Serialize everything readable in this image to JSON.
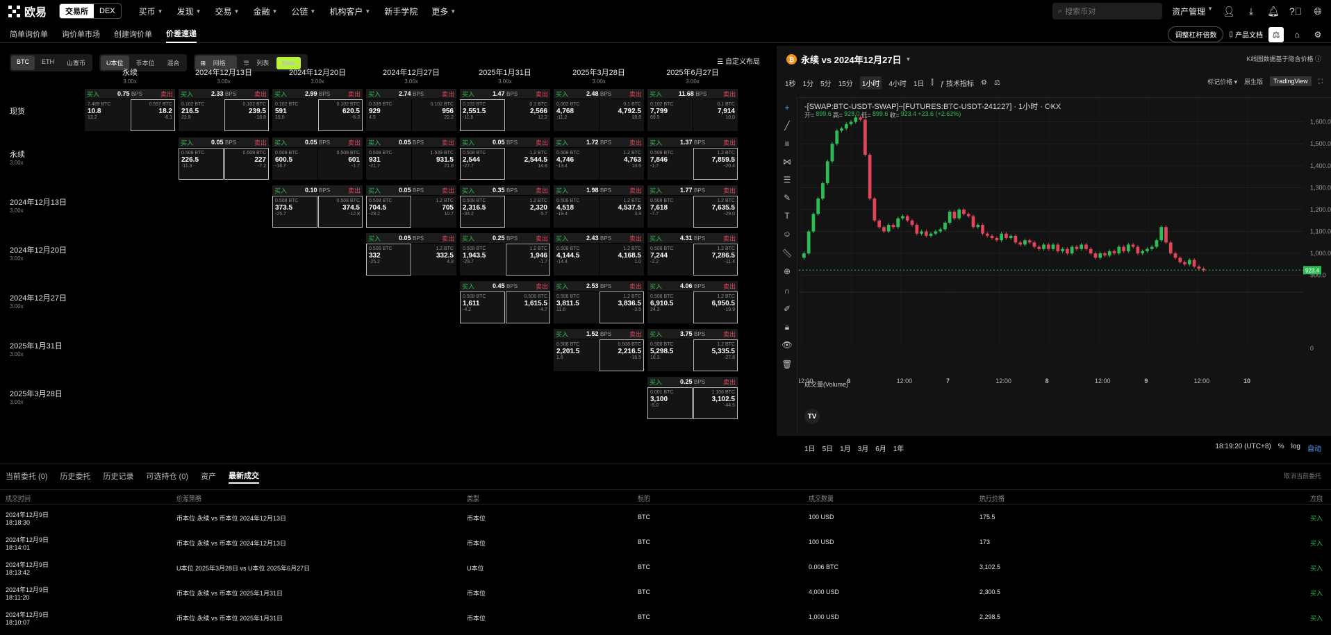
{
  "topnav": {
    "logo": "欧易",
    "mode_exchange": "交易所",
    "mode_dex": "DEX",
    "items": [
      "买币",
      "发现",
      "交易",
      "金融",
      "公链",
      "机构客户",
      "新手学院",
      "更多"
    ],
    "search_placeholder": "搜索币对",
    "asset_mgmt": "资产管理"
  },
  "subnav": {
    "items": [
      "简单询价单",
      "询价单市场",
      "创建询价单",
      "价差速递"
    ],
    "active_index": 3,
    "adjust_leverage": "调整杠杆倍数",
    "product_docs": "产品文档"
  },
  "filters": {
    "coins": [
      "BTC",
      "ETH",
      "山寨币"
    ],
    "units": [
      "U本位",
      "币本位",
      "混合"
    ],
    "views": [
      "网格",
      "列表"
    ],
    "new_badge": "New",
    "custom_layout": "自定义布局"
  },
  "grid": {
    "columns": [
      {
        "title": "永续",
        "multiplier": "3.00x"
      },
      {
        "title": "2024年12月13日",
        "multiplier": "3.00x"
      },
      {
        "title": "2024年12月20日",
        "multiplier": "3.00x"
      },
      {
        "title": "2024年12月27日",
        "multiplier": "3.00x"
      },
      {
        "title": "2025年1月31日",
        "multiplier": "3.00x"
      },
      {
        "title": "2025年3月28日",
        "multiplier": "3.00x"
      },
      {
        "title": "2025年6月27日",
        "multiplier": "3.00x"
      }
    ],
    "rows": [
      {
        "title": "现货",
        "multiplier": ""
      },
      {
        "title": "永续",
        "multiplier": "3.00x"
      },
      {
        "title": "2024年12月13日",
        "multiplier": "3.00x"
      },
      {
        "title": "2024年12月20日",
        "multiplier": "3.00x"
      },
      {
        "title": "2024年12月27日",
        "multiplier": "3.00x"
      },
      {
        "title": "2025年1月31日",
        "multiplier": "3.00x"
      },
      {
        "title": "2025年3月28日",
        "multiplier": "3.00x"
      }
    ],
    "buy_label": "买入",
    "sell_label": "卖出",
    "bps_unit": "BPS",
    "cells": [
      {
        "r": 0,
        "c": 0,
        "bps": "0.75",
        "la": "7.489 BTC",
        "lp": "10.8",
        "lc": "13.2",
        "ra": "0.557 BTC",
        "rp": "18.2",
        "rc": "-6.1",
        "sel": "r"
      },
      {
        "r": 0,
        "c": 1,
        "bps": "2.33",
        "la": "0.102 BTC",
        "lp": "216.5",
        "lc": "22.8",
        "ra": "0.102 BTC",
        "rp": "239.5",
        "rc": "-18.8",
        "sel": "r"
      },
      {
        "r": 0,
        "c": 2,
        "bps": "2.99",
        "la": "0.102 BTC",
        "lp": "591",
        "lc": "15.0",
        "ra": "0.102 BTC",
        "rp": "620.5",
        "rc": "-6.3",
        "sel": "r"
      },
      {
        "r": 0,
        "c": 3,
        "bps": "2.74",
        "la": "0.339 BTC",
        "lp": "929",
        "lc": "4.5",
        "ra": "0.102 BTC",
        "rp": "956",
        "rc": "22.2",
        "sel": ""
      },
      {
        "r": 0,
        "c": 4,
        "bps": "1.47",
        "la": "0.102 BTC",
        "lp": "2,551.5",
        "lc": "-11.0",
        "ra": "0.1 BTC",
        "rp": "2,566",
        "rc": "12.2",
        "sel": "l"
      },
      {
        "r": 0,
        "c": 5,
        "bps": "2.48",
        "la": "0.002 BTC",
        "lp": "4,768",
        "lc": "-11.2",
        "ra": "0.1 BTC",
        "rp": "4,792.5",
        "rc": "18.8",
        "sel": ""
      },
      {
        "r": 0,
        "c": 6,
        "bps": "11.68",
        "la": "0.102 BTC",
        "lp": "7,799",
        "lc": "69.5",
        "ra": "0.1 BTC",
        "rp": "7,914",
        "rc": "10.0",
        "sel": ""
      },
      {
        "r": 1,
        "c": 1,
        "bps": "0.05",
        "la": "0.508 BTC",
        "lp": "226.5",
        "lc": "-11.3",
        "ra": "0.508 BTC",
        "rp": "227",
        "rc": "-7.2",
        "sel": "both"
      },
      {
        "r": 1,
        "c": 2,
        "bps": "0.05",
        "la": "0.508 BTC",
        "lp": "600.5",
        "lc": "-18.7",
        "ra": "0.508 BTC",
        "rp": "601",
        "rc": "-1.7",
        "sel": ""
      },
      {
        "r": 1,
        "c": 3,
        "bps": "0.05",
        "la": "0.508 BTC",
        "lp": "931",
        "lc": "-21.7",
        "ra": "1.539 BTC",
        "rp": "931.5",
        "rc": "21.8",
        "sel": ""
      },
      {
        "r": 1,
        "c": 4,
        "bps": "0.05",
        "la": "0.508 BTC",
        "lp": "2,544",
        "lc": "-27.7",
        "ra": "1.2 BTC",
        "rp": "2,544.5",
        "rc": "14.8",
        "sel": "l"
      },
      {
        "r": 1,
        "c": 5,
        "bps": "1.72",
        "la": "0.508 BTC",
        "lp": "4,746",
        "lc": "-13.4",
        "ra": "1.2 BTC",
        "rp": "4,763",
        "rc": "13.5",
        "sel": ""
      },
      {
        "r": 1,
        "c": 6,
        "bps": "1.37",
        "la": "0.508 BTC",
        "lp": "7,846",
        "lc": "-1.7",
        "ra": "1.2 BTC",
        "rp": "7,859.5",
        "rc": "-20.4",
        "sel": "r"
      },
      {
        "r": 2,
        "c": 2,
        "bps": "0.10",
        "la": "0.508 BTC",
        "lp": "373.5",
        "lc": "-25.7",
        "ra": "0.508 BTC",
        "rp": "374.5",
        "rc": "-12.8",
        "sel": "both"
      },
      {
        "r": 2,
        "c": 3,
        "bps": "0.05",
        "la": "0.508 BTC",
        "lp": "704.5",
        "lc": "-29.2",
        "ra": "1.2 BTC",
        "rp": "705",
        "rc": "10.7",
        "sel": "l"
      },
      {
        "r": 2,
        "c": 4,
        "bps": "0.35",
        "la": "0.508 BTC",
        "lp": "2,316.5",
        "lc": "-34.2",
        "ra": "1.2 BTC",
        "rp": "2,320",
        "rc": "5.7",
        "sel": "l"
      },
      {
        "r": 2,
        "c": 5,
        "bps": "1.98",
        "la": "0.508 BTC",
        "lp": "4,518",
        "lc": "-19.4",
        "ra": "1.2 BTC",
        "rp": "4,537.5",
        "rc": "3.3",
        "sel": ""
      },
      {
        "r": 2,
        "c": 6,
        "bps": "1.77",
        "la": "0.508 BTC",
        "lp": "7,618",
        "lc": "-7.7",
        "ra": "1.2 BTC",
        "rp": "7,635.5",
        "rc": "-29.0",
        "sel": "r"
      },
      {
        "r": 3,
        "c": 3,
        "bps": "0.05",
        "la": "0.508 BTC",
        "lp": "332",
        "lc": "-25.2",
        "ra": "1.2 BTC",
        "rp": "332.5",
        "rc": "4.8",
        "sel": "l"
      },
      {
        "r": 3,
        "c": 4,
        "bps": "0.25",
        "la": "0.508 BTC",
        "lp": "1,943.5",
        "lc": "-29.7",
        "ra": "1.2 BTC",
        "rp": "1,946",
        "rc": "-1.7",
        "sel": "r"
      },
      {
        "r": 3,
        "c": 5,
        "bps": "2.43",
        "la": "0.508 BTC",
        "lp": "4,144.5",
        "lc": "-14.4",
        "ra": "1.2 BTC",
        "rp": "4,168.5",
        "rc": "1.0",
        "sel": ""
      },
      {
        "r": 3,
        "c": 6,
        "bps": "4.31",
        "la": "0.508 BTC",
        "lp": "7,244",
        "lc": "-2.2",
        "ra": "1.2 BTC",
        "rp": "7,286.5",
        "rc": "-11.4",
        "sel": "r"
      },
      {
        "r": 4,
        "c": 4,
        "bps": "0.45",
        "la": "0.508 BTC",
        "lp": "1,611",
        "lc": "-4.2",
        "ra": "0.508 BTC",
        "rp": "1,615.5",
        "rc": "-4.7",
        "sel": "both"
      },
      {
        "r": 4,
        "c": 5,
        "bps": "2.53",
        "la": "0.508 BTC",
        "lp": "3,811.5",
        "lc": "11.6",
        "ra": "1.2 BTC",
        "rp": "3,836.5",
        "rc": "-3.5",
        "sel": "r"
      },
      {
        "r": 4,
        "c": 6,
        "bps": "4.06",
        "la": "0.508 BTC",
        "lp": "6,910.5",
        "lc": "24.3",
        "ra": "1.2 BTC",
        "rp": "6,950.5",
        "rc": "-19.9",
        "sel": "r"
      },
      {
        "r": 5,
        "c": 5,
        "bps": "1.52",
        "la": "0.508 BTC",
        "lp": "2,201.5",
        "lc": "1.6",
        "ra": "0.508 BTC",
        "rp": "2,216.5",
        "rc": "-16.5",
        "sel": "r"
      },
      {
        "r": 5,
        "c": 6,
        "bps": "3.75",
        "la": "0.508 BTC",
        "lp": "5,298.5",
        "lc": "16.3",
        "ra": "1.2 BTC",
        "rp": "5,335.5",
        "rc": "-27.8",
        "sel": "r"
      },
      {
        "r": 6,
        "c": 6,
        "bps": "0.25",
        "la": "0.001 BTC",
        "lp": "3,100",
        "lc": "-5.0",
        "ra": "1.106 BTC",
        "rp": "3,102.5",
        "rc": "-44.5",
        "sel": "both"
      }
    ]
  },
  "chart_panel": {
    "title": "永续 vs 2024年12月27日",
    "note": "K线图数据基于隐含价格",
    "timeframes": [
      "1秒",
      "1分",
      "5分",
      "15分",
      "1小时",
      "4小时",
      "1日"
    ],
    "active_timeframe": "1小时",
    "indicators_label": "技术指标",
    "mark_price": "标记价格",
    "original": "原生版",
    "tradingview": "TradingView",
    "symbol": "-[SWAP:BTC-USDT-SWAP]+[FUTURES:BTC-USDT-241227] · 1小时 · OKX",
    "ohlc": {
      "open_label": "开=",
      "open": "899.6",
      "high_label": "高=",
      "high": "928.0",
      "low_label": "低=",
      "low": "899.6",
      "close_label": "收=",
      "close": "923.4",
      "change": "+23.6 (+2.62%)"
    },
    "volume_label": "成交量(Volume)",
    "volume_zero": "0",
    "last_price": "923.4",
    "time_display": "18:19:20 (UTC+8)",
    "ranges": [
      "1日",
      "5日",
      "1月",
      "3月",
      "6月",
      "1年"
    ],
    "percent_label": "%",
    "log_label": "log",
    "auto_label": "自动"
  },
  "chart_data": {
    "type": "candlestick",
    "y_ticks": [
      "1,600.0",
      "1,500.0",
      "1,400.0",
      "1,300.0",
      "1,200.0",
      "1,100.0",
      "1,000.0",
      "900.0"
    ],
    "ylim": [
      880,
      1640
    ],
    "x_ticks": [
      "12:00",
      "6",
      "12:00",
      "7",
      "12:00",
      "8",
      "12:00",
      "9",
      "12:00",
      "10"
    ],
    "closes": [
      1000,
      1100,
      1180,
      1250,
      1320,
      1420,
      1500,
      1560,
      1570,
      1590,
      1600,
      1620,
      1610,
      1450,
      1250,
      1150,
      1120,
      1100,
      1130,
      1120,
      1160,
      1170,
      1150,
      1130,
      1090,
      1100,
      1080,
      1090,
      1100,
      1110,
      1140,
      1190,
      1160,
      1200,
      1180,
      1170,
      1120,
      1130,
      1090,
      1080,
      1070,
      1060,
      1090,
      1070,
      1080,
      1050,
      1040,
      1060,
      1050,
      1030,
      1020,
      1040,
      1020,
      1040,
      1010,
      1020,
      1000,
      1030,
      1020,
      1040,
      1020,
      1000,
      980,
      1000,
      990,
      1010,
      1000,
      1030,
      1010,
      1040,
      1030,
      1000,
      1010,
      1020,
      1030,
      1060,
      1120,
      1050,
      1000,
      980,
      960,
      950,
      970,
      940,
      930,
      923.4
    ]
  },
  "bottom": {
    "tabs": [
      "当前委托 (0)",
      "历史委托",
      "历史记录",
      "可选持仓 (0)",
      "资产",
      "最新成交"
    ],
    "active_tab": 5,
    "cancel_all": "取消当前委托",
    "headers": [
      "成交时间",
      "价差策略",
      "类型",
      "标的",
      "成交数量",
      "执行价格",
      "方向"
    ],
    "rows": [
      {
        "date": "2024年12月9日",
        "time": "18:18:30",
        "strategy": "币本位 永续 vs 币本位 2024年12月13日",
        "type": "币本位",
        "asset": "BTC",
        "qty": "100 USD",
        "price": "175.5",
        "side": "买入"
      },
      {
        "date": "2024年12月9日",
        "time": "18:14:01",
        "strategy": "币本位 永续 vs 币本位 2024年12月13日",
        "type": "币本位",
        "asset": "BTC",
        "qty": "100 USD",
        "price": "173",
        "side": "买入"
      },
      {
        "date": "2024年12月9日",
        "time": "18:13:42",
        "strategy": "U本位 2025年3月28日 vs U本位 2025年6月27日",
        "type": "U本位",
        "asset": "BTC",
        "qty": "0.006 BTC",
        "price": "3,102.5",
        "side": "买入"
      },
      {
        "date": "2024年12月9日",
        "time": "18:11:20",
        "strategy": "币本位 永续 vs 币本位 2025年1月31日",
        "type": "币本位",
        "asset": "BTC",
        "qty": "4,000 USD",
        "price": "2,300.5",
        "side": "买入"
      },
      {
        "date": "2024年12月9日",
        "time": "18:10:07",
        "strategy": "币本位 永续 vs 币本位 2025年1月31日",
        "type": "币本位",
        "asset": "BTC",
        "qty": "1,000 USD",
        "price": "2,298.5",
        "side": "买入"
      }
    ]
  }
}
